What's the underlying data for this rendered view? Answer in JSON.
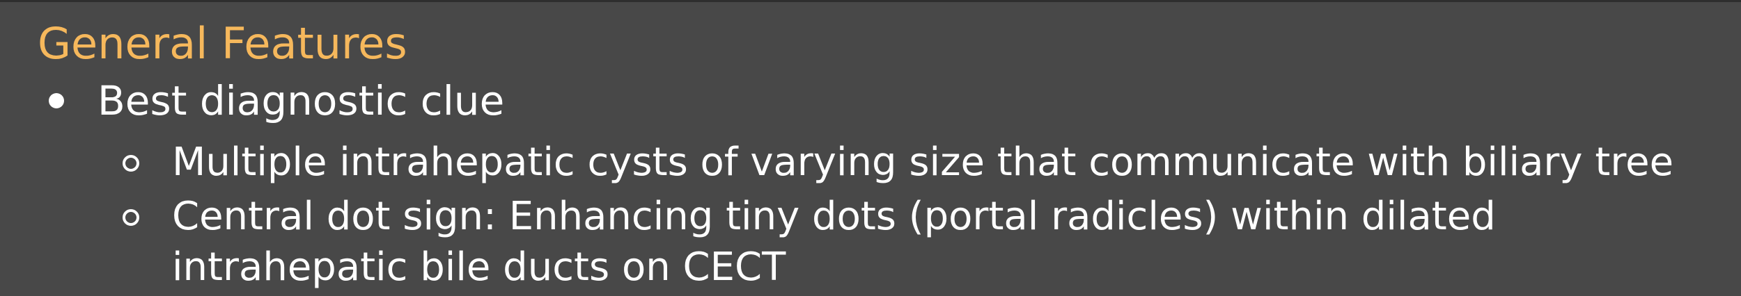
{
  "section": {
    "heading": "General Features"
  },
  "bullets": [
    {
      "text": "Best diagnostic clue",
      "children": [
        {
          "text": "Multiple intrahepatic cysts of varying size that communicate with biliary tree"
        },
        {
          "text": "Central dot sign: Enhancing tiny dots (portal radicles) within dilated intrahepatic bile ducts on CECT"
        }
      ]
    }
  ],
  "colors": {
    "background": "#484848",
    "heading": "#f6b85c",
    "text": "#ffffff"
  }
}
